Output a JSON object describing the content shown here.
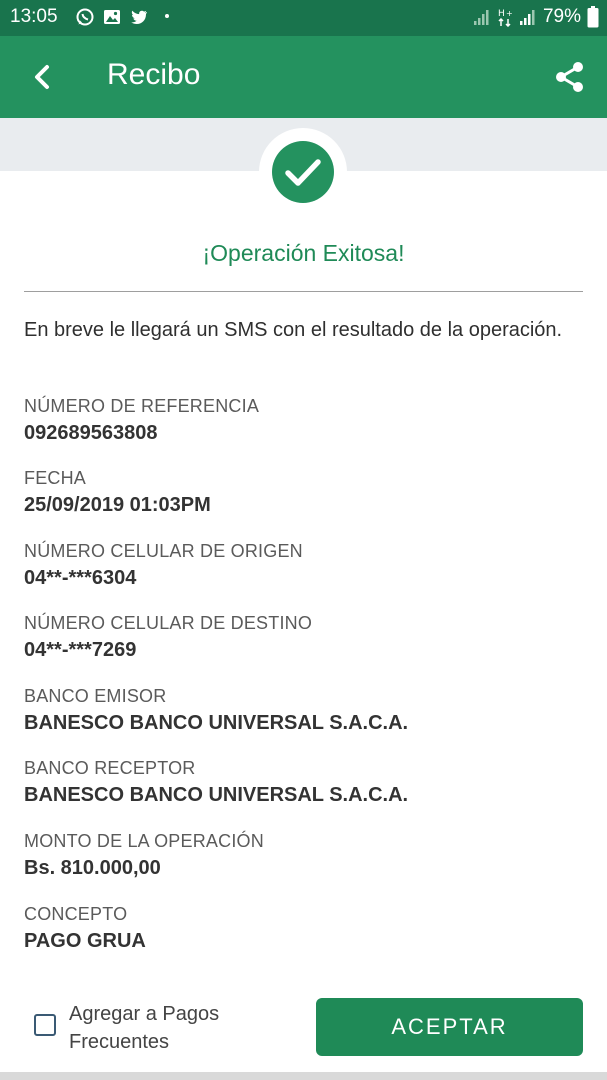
{
  "status_bar": {
    "time": "13:05",
    "battery": "79%",
    "left_icons": [
      "whatsapp-icon",
      "image-icon",
      "twitter-icon"
    ],
    "right_icons": [
      "signal-weak-icon",
      "data-transfer-icon",
      "signal-icon"
    ]
  },
  "app_bar": {
    "title": "Recibo",
    "back_icon": "arrow-back-icon",
    "share_icon": "share-icon"
  },
  "colors": {
    "primary": "#24925f",
    "primary_dark": "#19744d",
    "accent_text": "#1f8a57"
  },
  "receipt": {
    "status_icon": "check-circle-icon",
    "title": "¡Operación Exitosa!",
    "message": "En breve le llegará un SMS con el resultado de la operación.",
    "fields": [
      {
        "label": "NÚMERO DE REFERENCIA",
        "value": "092689563808"
      },
      {
        "label": "FECHA",
        "value": "25/09/2019 01:03PM"
      },
      {
        "label": "NÚMERO CELULAR DE ORIGEN",
        "value": "04**-***6304"
      },
      {
        "label": "NÚMERO CELULAR DE DESTINO",
        "value": "04**-***7269"
      },
      {
        "label": "BANCO EMISOR",
        "value": "BANESCO BANCO UNIVERSAL S.A.C.A."
      },
      {
        "label": "BANCO RECEPTOR",
        "value": "BANESCO BANCO UNIVERSAL S.A.C.A."
      },
      {
        "label": "MONTO DE LA OPERACIÓN",
        "value": "Bs. 810.000,00"
      },
      {
        "label": "CONCEPTO",
        "value": "PAGO GRUA"
      }
    ]
  },
  "footer": {
    "checkbox_label": "Agregar a Pagos Frecuentes",
    "checkbox_checked": false,
    "accept_label": "ACEPTAR"
  }
}
